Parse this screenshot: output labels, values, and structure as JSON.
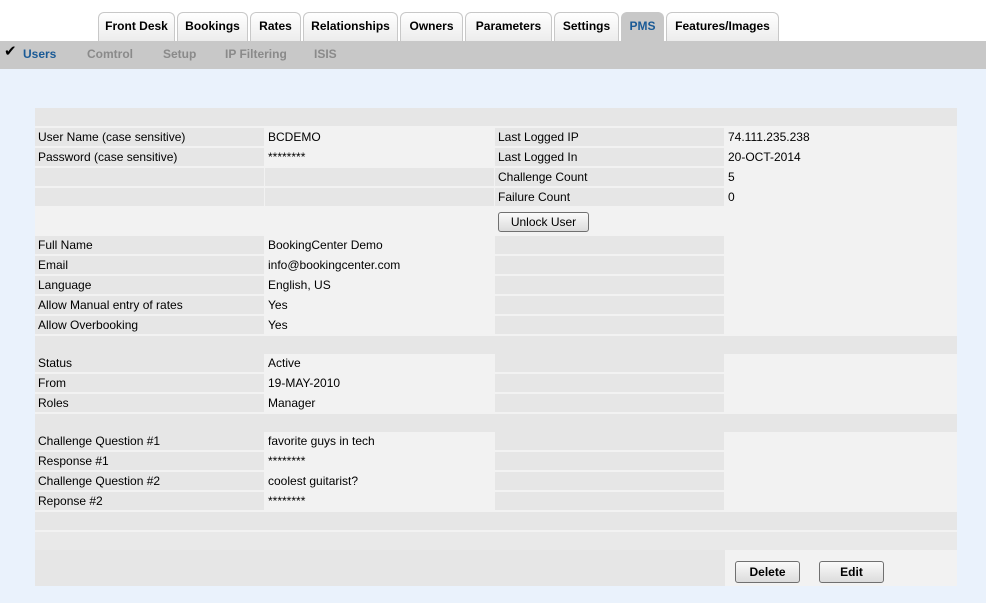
{
  "tabs": [
    "Front Desk",
    "Bookings",
    "Rates",
    "Relationships",
    "Owners",
    "Parameters",
    "Settings",
    "PMS",
    "Features/Images"
  ],
  "active_tab": "PMS",
  "subnav": [
    "Users",
    "Comtrol",
    "Setup",
    "IP Filtering",
    "ISIS"
  ],
  "active_subnav": "Users",
  "icons": {
    "active_marker": "checkmark-icon"
  },
  "colors": {
    "active_tab_text": "#1a5a96",
    "content_bg": "#eaf2fc",
    "bar_bg": "#c8c8c8"
  },
  "user": {
    "username_label": "User Name (case sensitive)",
    "username": "BCDEMO",
    "password_label": "Password (case sensitive)",
    "password": "********",
    "last_ip_label": "Last Logged IP",
    "last_ip": "74.111.235.238",
    "last_in_label": "Last Logged In",
    "last_in": "20-OCT-2014",
    "challenge_count_label": "Challenge Count",
    "challenge_count": "5",
    "failure_count_label": "Failure Count",
    "failure_count": "0",
    "unlock_label": "Unlock User",
    "fullname_label": "Full Name",
    "fullname": "BookingCenter Demo",
    "email_label": "Email",
    "email": "info@bookingcenter.com",
    "language_label": "Language",
    "language": "English, US",
    "manual_rates_label": "Allow Manual entry of rates",
    "manual_rates": "Yes",
    "overbooking_label": "Allow Overbooking",
    "overbooking": "Yes",
    "status_label": "Status",
    "status": "Active",
    "from_label": "From",
    "from": "19-MAY-2010",
    "roles_label": "Roles",
    "roles": "Manager",
    "q1_label": "Challenge Question #1",
    "q1": "favorite guys in tech",
    "r1_label": "Response #1",
    "r1": "********",
    "q2_label": "Challenge Question #2",
    "q2": "coolest guitarist?",
    "r2_label": "Reponse #2",
    "r2": "********"
  },
  "actions": {
    "delete": "Delete",
    "edit": "Edit"
  }
}
